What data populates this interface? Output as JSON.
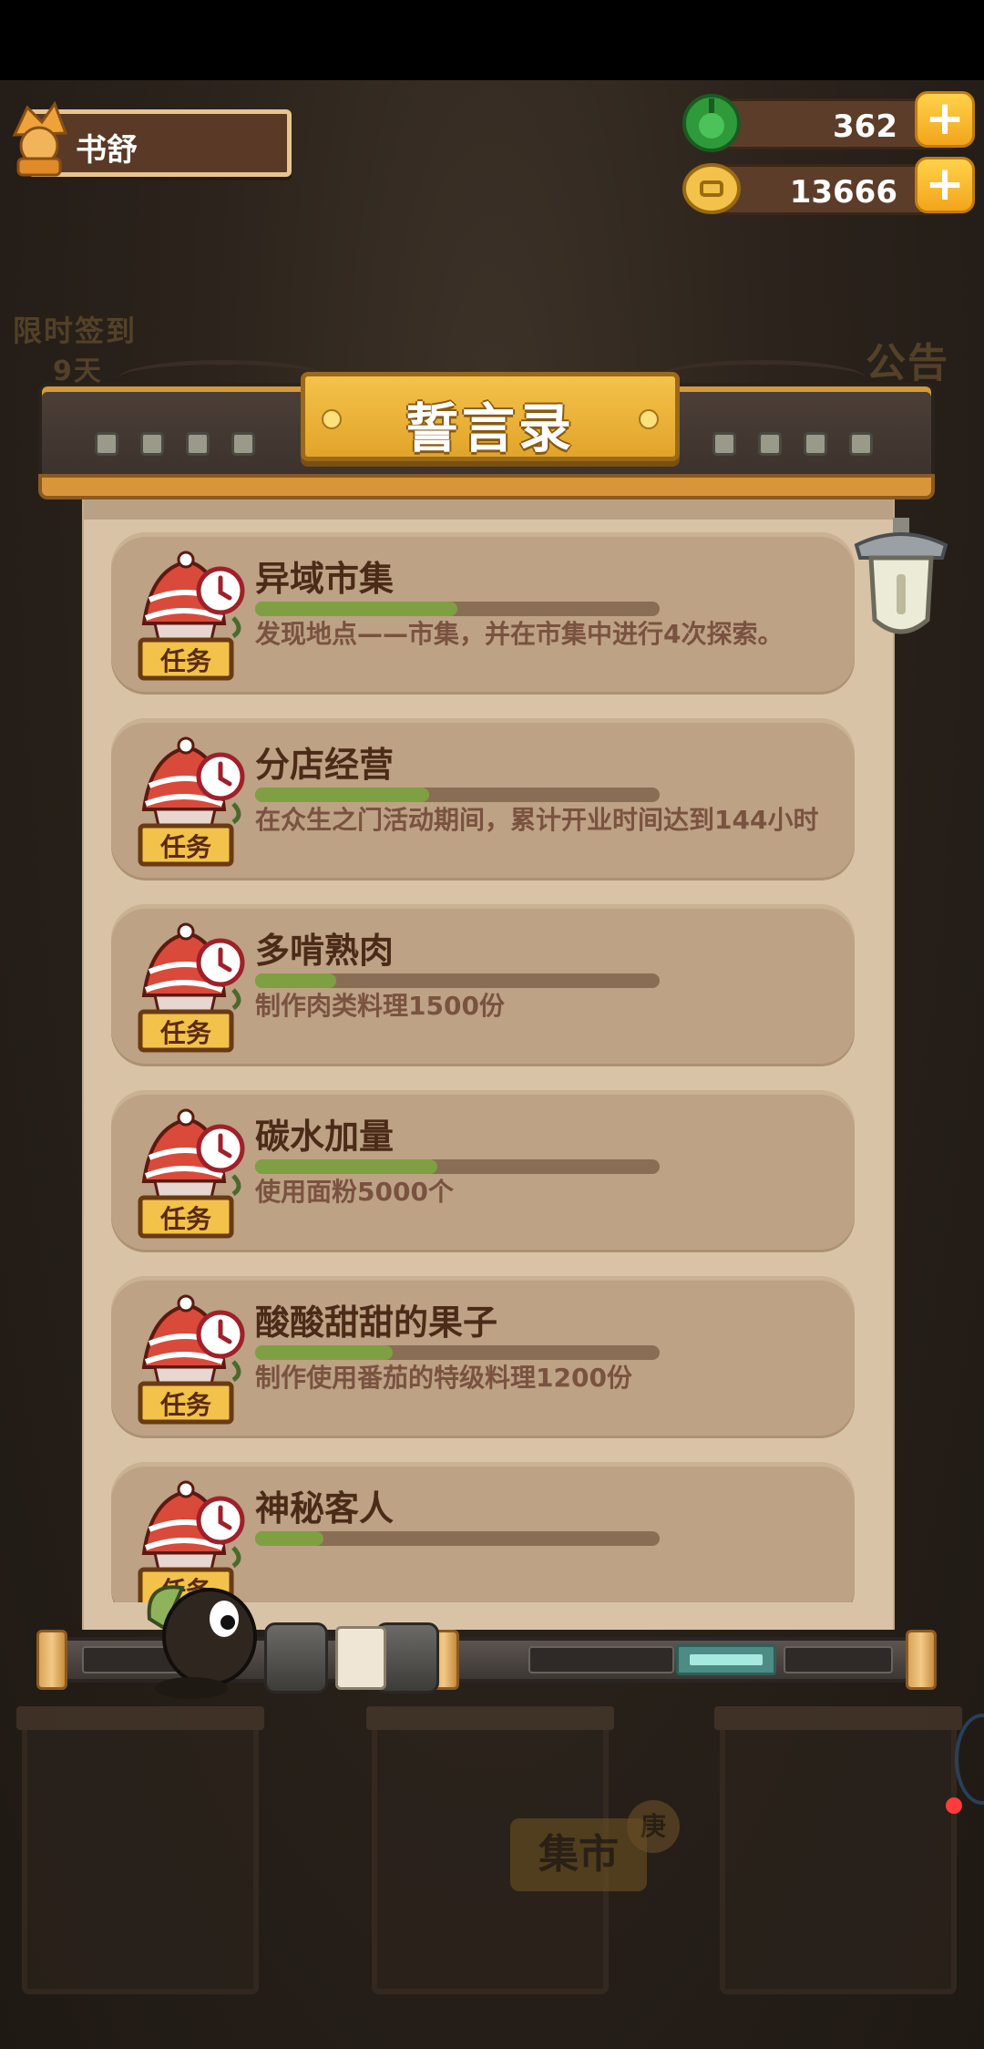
{
  "hud": {
    "player_name": "书舒",
    "jade": "362",
    "coins": "13666",
    "plus": "+"
  },
  "header": {
    "title": "誓言录"
  },
  "background": {
    "checkin_label": "限时签到",
    "checkin_days": "9天",
    "announcement_label": "公告",
    "market_sign": "集市",
    "market_badge": "庚"
  },
  "task_badge": "任务",
  "tasks": [
    {
      "title": "异域市集",
      "progress": 0.5,
      "description": "发现地点——市集，并在市集中进行4次探索。"
    },
    {
      "title": "分店经营",
      "progress": 0.43,
      "description": "在众生之门活动期间，累计开业时间达到144小时"
    },
    {
      "title": "多啃熟肉",
      "progress": 0.2,
      "description": "制作肉类料理1500份"
    },
    {
      "title": "碳水加量",
      "progress": 0.45,
      "description": "使用面粉5000个"
    },
    {
      "title": "酸酸甜甜的果子",
      "progress": 0.34,
      "description": "制作使用番茄的特级料理1200份"
    },
    {
      "title": "神秘客人",
      "progress": 0.17,
      "description": ""
    }
  ],
  "colors": {
    "card_bg": "#bda285",
    "progress_fill": "#7ea043",
    "progress_track": "#8a6d55",
    "title_text": "#4b2b18",
    "desc_text": "#7a5240",
    "badge_bg": "#f2c24a"
  }
}
